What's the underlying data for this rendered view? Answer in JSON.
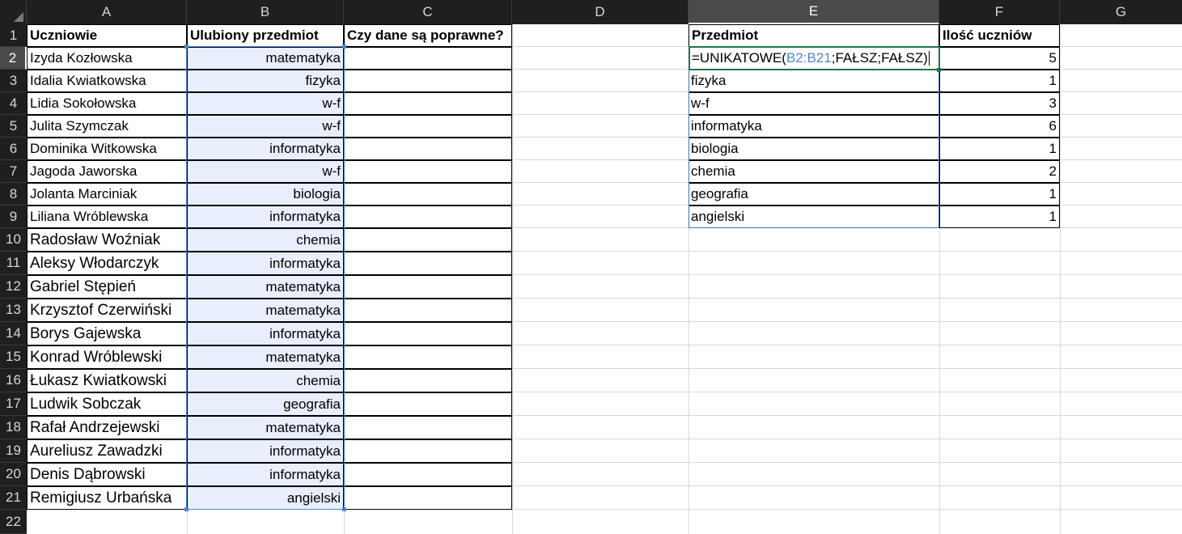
{
  "columns": [
    "A",
    "B",
    "C",
    "D",
    "E",
    "F",
    "G"
  ],
  "rows": [
    "1",
    "2",
    "3",
    "4",
    "5",
    "6",
    "7",
    "8",
    "9",
    "10",
    "11",
    "12",
    "13",
    "14",
    "15",
    "16",
    "17",
    "18",
    "19",
    "20",
    "21",
    "22"
  ],
  "selected_column": "E",
  "selected_row": "2",
  "table1": {
    "header_students": "Uczniowie",
    "header_subject": "Ulubiony przedmiot",
    "header_check": "Czy dane są poprawne?",
    "students": [
      "Izyda Kozłowska",
      "Idalia Kwiatkowska",
      "Lidia Sokołowska",
      "Julita Szymczak",
      "Dominika Witkowska",
      "Jagoda Jaworska",
      "Jolanta Marciniak",
      "Liliana Wróblewska",
      "Radosław Woźniak",
      "Aleksy Włodarczyk",
      "Gabriel Stępień",
      "Krzysztof Czerwiński",
      "Borys Gajewska",
      "Konrad Wróblewski",
      "Łukasz Kwiatkowski",
      "Ludwik Sobczak",
      "Rafał Andrzejewski",
      "Aureliusz Zawadzki",
      "Denis Dąbrowski",
      "Remigiusz Urbańska"
    ],
    "subjects": [
      "matematyka",
      "fizyka",
      "w-f",
      "w-f",
      "informatyka",
      "w-f",
      "biologia",
      "informatyka",
      "chemia",
      "informatyka",
      "matematyka",
      "matematyka",
      "informatyka",
      "matematyka",
      "chemia",
      "geografia",
      "matematyka",
      "informatyka",
      "informatyka",
      "angielski"
    ]
  },
  "table2": {
    "header_subject": "Przedmiot",
    "header_count": "Ilość uczniów",
    "formula_prefix": "=UNIKATOWE(",
    "formula_ref": "B2:B21",
    "formula_suffix": ";FAŁSZ;FAŁSZ)",
    "subjects": [
      "fizyka",
      "w-f",
      "informatyka",
      "biologia",
      "chemia",
      "geografia",
      "angielski"
    ],
    "counts": [
      "5",
      "1",
      "3",
      "6",
      "1",
      "2",
      "1",
      "1"
    ]
  },
  "colors": {
    "header_bg": "#1f1f1f",
    "selection_fill": "#e8eefc",
    "reference_blue": "#4f86d8",
    "active_cell_green": "#217346"
  }
}
